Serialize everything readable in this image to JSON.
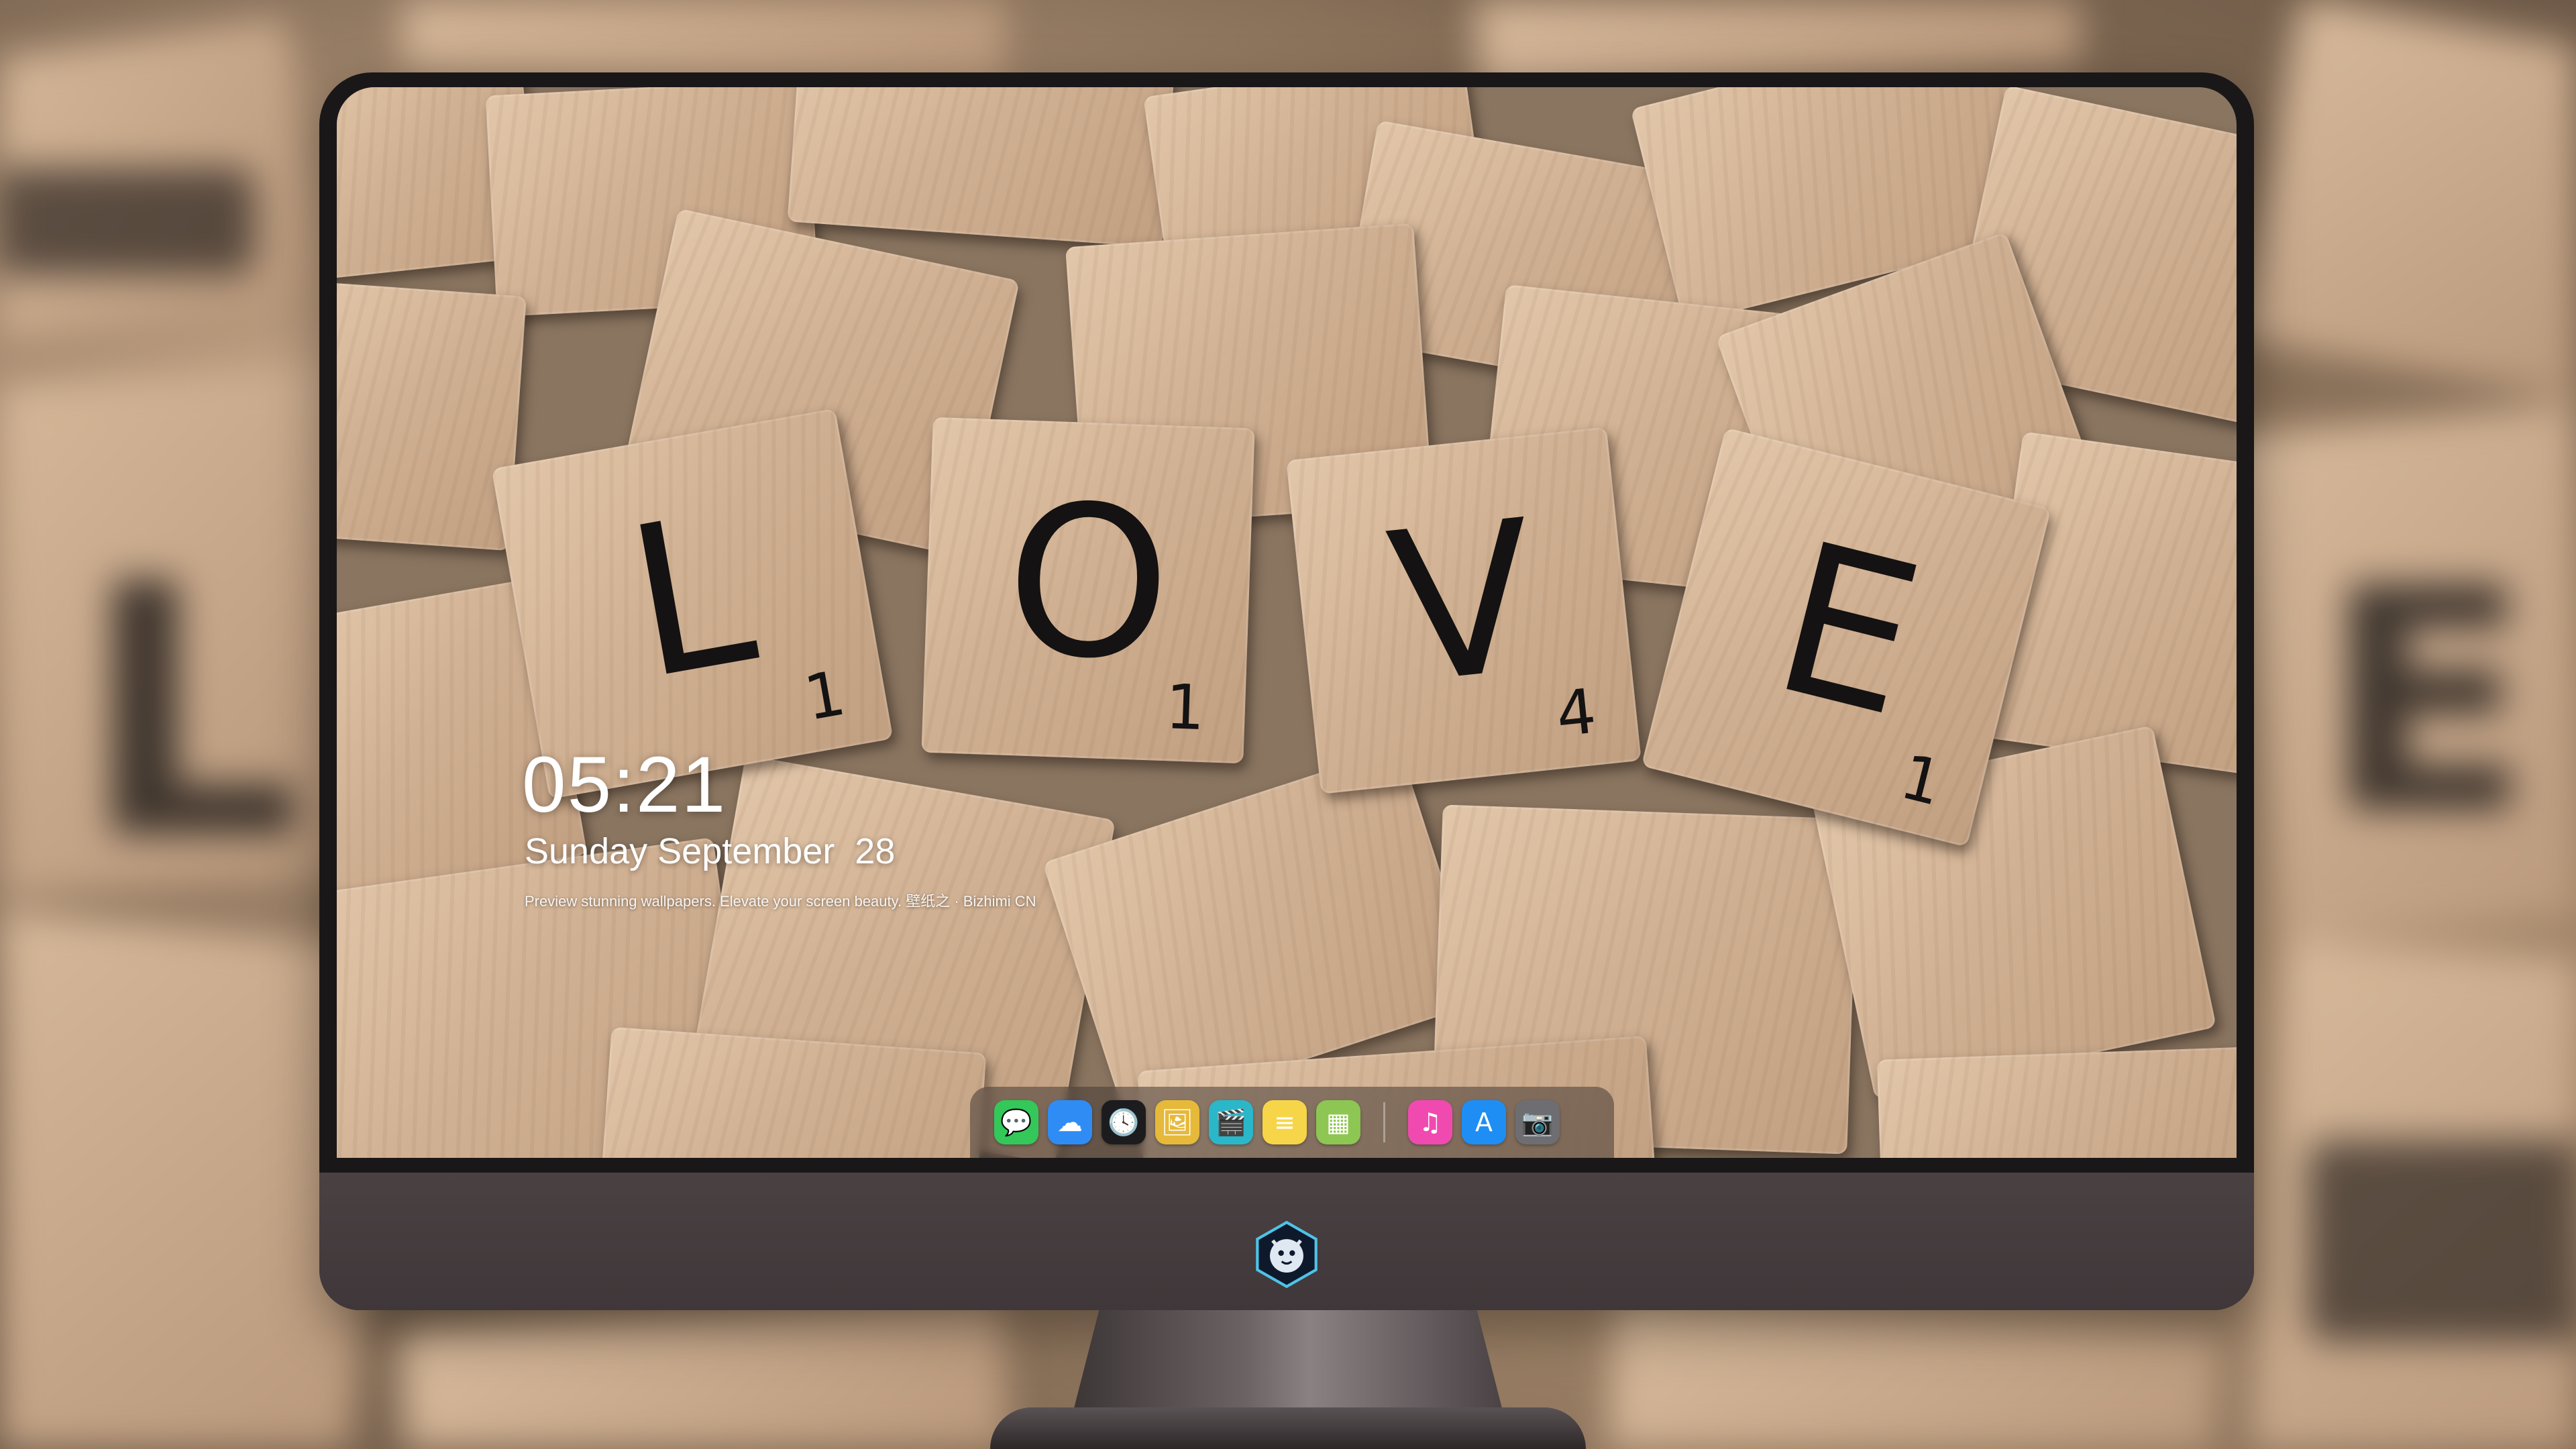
{
  "lockscreen": {
    "time": "05:21",
    "date": "Sunday September  28",
    "tagline": "Preview stunning wallpapers. Elevate your screen beauty. 壁纸之 · Bizhimi CN"
  },
  "wallpaper": {
    "tiles": [
      {
        "letter": "L",
        "value": "1"
      },
      {
        "letter": "O",
        "value": "1"
      },
      {
        "letter": "V",
        "value": "4"
      },
      {
        "letter": "E",
        "value": "1"
      }
    ]
  },
  "dock": {
    "apps": [
      {
        "name": "messages-icon",
        "glyph": "💬",
        "color": "#34c759"
      },
      {
        "name": "weather-icon",
        "glyph": "☁",
        "color": "#2f8cf5"
      },
      {
        "name": "clock-icon",
        "glyph": "🕓",
        "color": "#1c1c1e"
      },
      {
        "name": "preview-icon",
        "glyph": "🖼",
        "color": "#e6b93a"
      },
      {
        "name": "clapper-icon",
        "glyph": "🎬",
        "color": "#2ab7ca"
      },
      {
        "name": "notes-icon",
        "glyph": "≡",
        "color": "#f7d548"
      },
      {
        "name": "photo-booth-icon",
        "glyph": "▦",
        "color": "#8ec653"
      },
      {
        "name": "music-icon",
        "glyph": "♫",
        "color": "#f04ab0"
      },
      {
        "name": "app-store-icon",
        "glyph": "A",
        "color": "#1e8ef5"
      },
      {
        "name": "camera-icon",
        "glyph": "📷",
        "color": "#6e6e72"
      }
    ]
  },
  "colors": {
    "bezel": "#1a1718",
    "chin": "#443b3d",
    "tile_wood": "#d1b193"
  }
}
